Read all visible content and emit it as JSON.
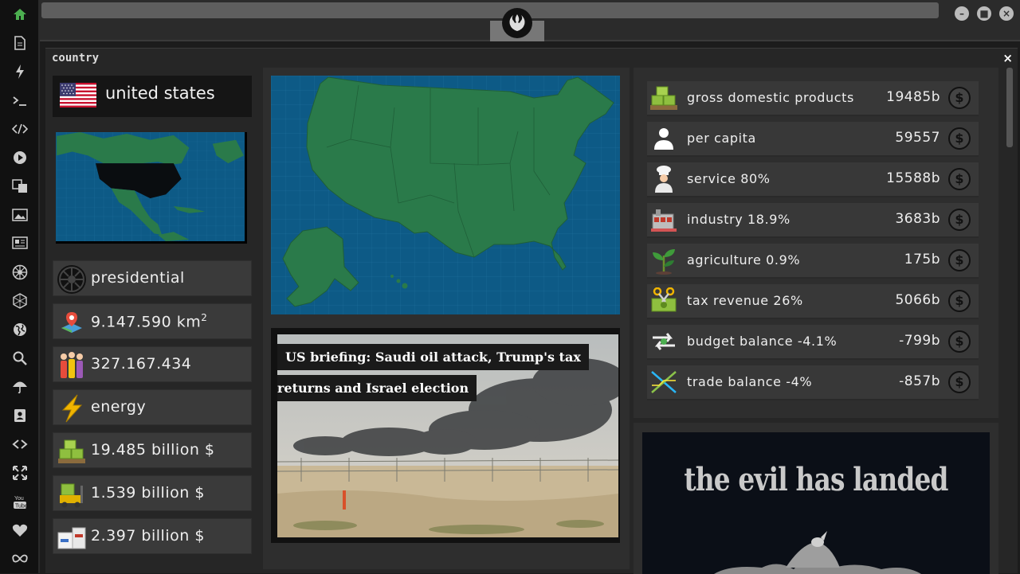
{
  "sidebar": {
    "icons": [
      "home-icon",
      "document-icon",
      "bolt-icon",
      "terminal-icon",
      "code-icon",
      "play-icon",
      "translate-icon",
      "image-icon",
      "news-icon",
      "empire-icon",
      "hexagon-icon",
      "globe-icon",
      "search-icon",
      "umbrella-icon",
      "contact-icon",
      "link-icon",
      "expand-icon",
      "youtube-icon",
      "heart-icon",
      "infinity-icon"
    ]
  },
  "window": {
    "logo": "rebel-alliance-logo"
  },
  "panel": {
    "title": "country",
    "close": "×"
  },
  "country": {
    "name": "united states",
    "government": "presidential",
    "area": "9.147.590 km",
    "area_sup": "2",
    "population": "327.167.434",
    "resource": "energy",
    "gdp": "19.485 billion $",
    "export": "1.539 billion $",
    "import": "2.397 billion $"
  },
  "news": {
    "headline_line1": "US briefing: Saudi oil attack, Trump's tax",
    "headline_line2": "returns and Israel election"
  },
  "stats": [
    {
      "label": "gross domestic products",
      "value": "19485b",
      "icon": "money-pallet-icon"
    },
    {
      "label": "per capita",
      "value": "59557",
      "icon": "person-icon"
    },
    {
      "label": "service 80%",
      "value": "15588b",
      "icon": "chef-icon"
    },
    {
      "label": "industry 18.9%",
      "value": "3683b",
      "icon": "factory-icon"
    },
    {
      "label": "agriculture 0.9%",
      "value": "175b",
      "icon": "plant-icon"
    },
    {
      "label": "tax revenue 26%",
      "value": "5066b",
      "icon": "tax-scissors-icon"
    },
    {
      "label": "budget balance -4.1%",
      "value": "-799b",
      "icon": "exchange-icon"
    },
    {
      "label": "trade balance -4%",
      "value": "-857b",
      "icon": "trade-cross-icon"
    }
  ],
  "dollar_symbol": "$",
  "ad": {
    "text": "the evil has landed"
  },
  "colors": {
    "accent": "#4caf50",
    "map_land": "#2a7a4a",
    "map_sea": "#0d5a86"
  }
}
